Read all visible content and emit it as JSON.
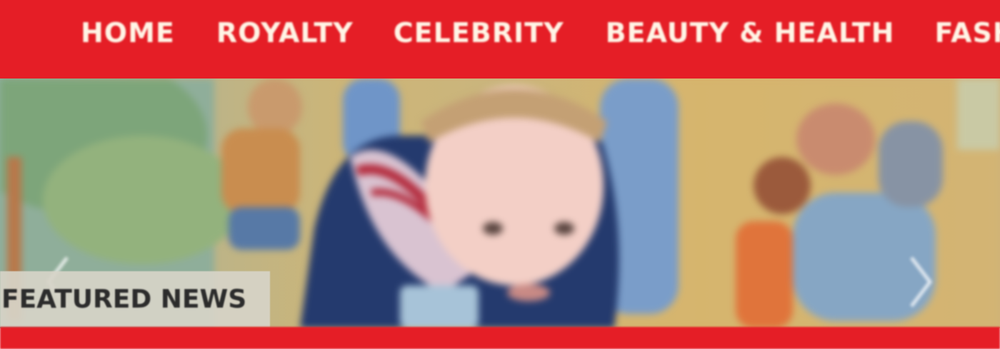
{
  "nav": {
    "items": [
      {
        "label": "HOME"
      },
      {
        "label": "ROYALTY"
      },
      {
        "label": "CELEBRITY"
      },
      {
        "label": "BEAUTY & HEALTH"
      },
      {
        "label": "FASHION"
      }
    ]
  },
  "hero": {
    "section_label": "FEATURED NEWS"
  },
  "colors": {
    "brand_red": "#e51e26",
    "nav_text": "#fff5e6"
  },
  "icons": {
    "prev": "chevron-left-icon",
    "next": "chevron-right-icon"
  }
}
